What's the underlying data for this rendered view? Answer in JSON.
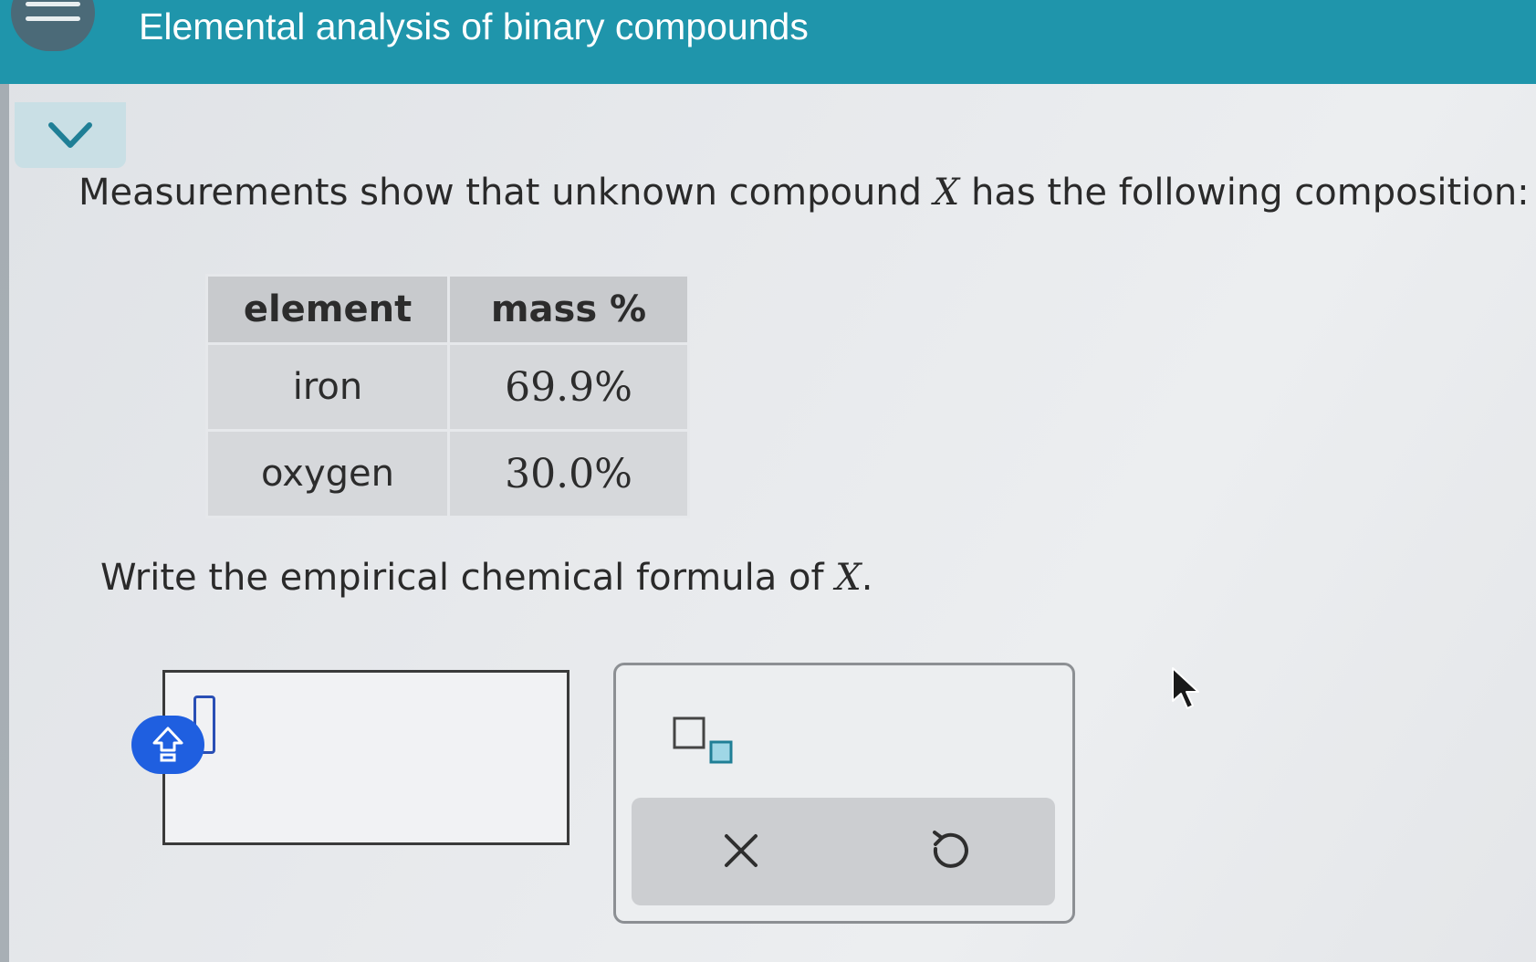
{
  "header": {
    "title": "Elemental analysis of binary compounds",
    "menu_icon": "hamburger-menu-icon",
    "accent_color": "#1f95ab"
  },
  "collapse": {
    "icon": "chevron-down-icon"
  },
  "question": {
    "text_before": "Measurements show that unknown compound ",
    "variable": "X",
    "text_after": " has the following composition:"
  },
  "table": {
    "headers": [
      "element",
      "mass %"
    ],
    "rows": [
      {
        "element": "iron",
        "mass": "69.9%"
      },
      {
        "element": "oxygen",
        "mass": "30.0%"
      }
    ]
  },
  "prompt": {
    "text_before": "Write the empirical chemical formula of ",
    "variable": "X",
    "text_after": "."
  },
  "answer": {
    "value": "",
    "keyboard_icon": "keyboard-toggle-icon"
  },
  "tools": {
    "subscript_icon": "subscript-template-icon",
    "clear_icon": "close-icon",
    "clear_symbol": "×",
    "undo_icon": "undo-icon"
  }
}
